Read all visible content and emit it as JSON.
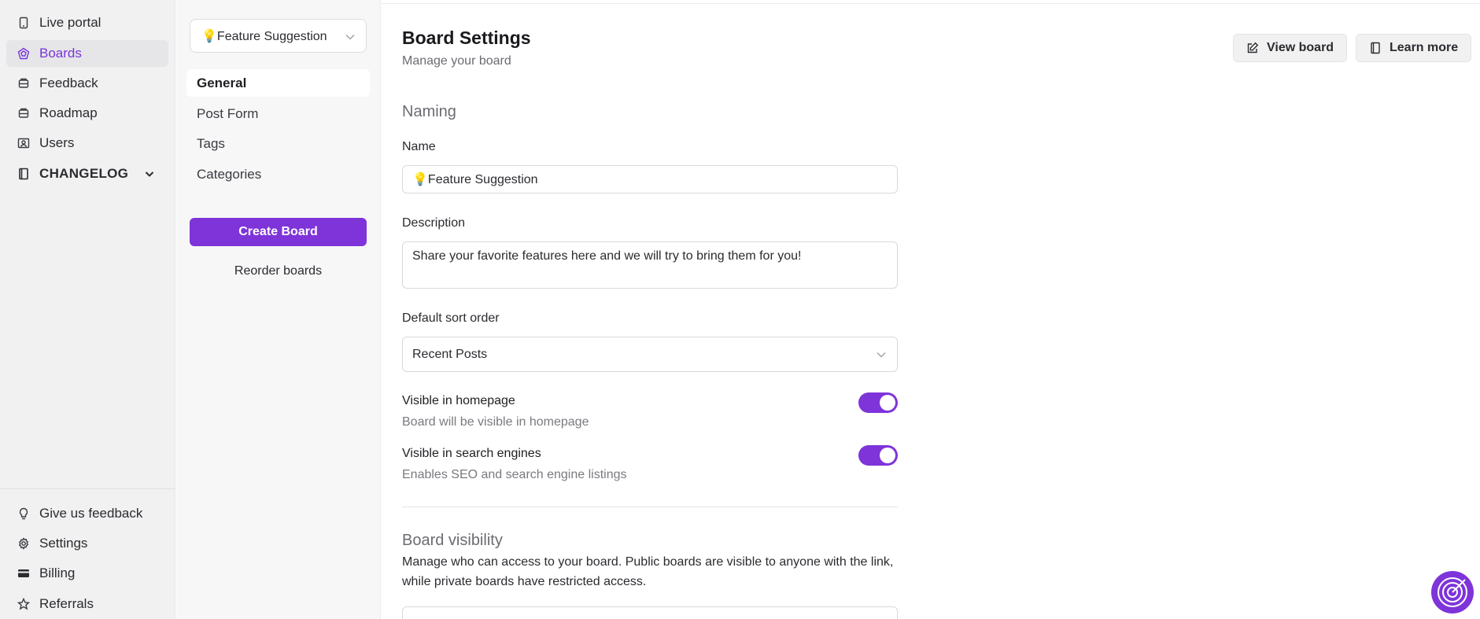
{
  "sidebar": {
    "items": [
      {
        "label": "Live portal",
        "icon": "tablet-icon"
      },
      {
        "label": "Boards",
        "icon": "boards-icon",
        "active": true
      },
      {
        "label": "Feedback",
        "icon": "inbox-icon"
      },
      {
        "label": "Roadmap",
        "icon": "inbox-icon"
      },
      {
        "label": "Users",
        "icon": "users-icon"
      },
      {
        "label": "CHANGELOG",
        "icon": "book-icon"
      }
    ],
    "bottom_items": [
      {
        "label": "Give us feedback",
        "icon": "lightbulb-icon"
      },
      {
        "label": "Settings",
        "icon": "gear-icon"
      },
      {
        "label": "Billing",
        "icon": "credit-card-icon"
      },
      {
        "label": "Referrals",
        "icon": "star-icon"
      }
    ]
  },
  "board_panel": {
    "selected_board": "💡Feature Suggestion",
    "tabs": [
      "General",
      "Post Form",
      "Tags",
      "Categories"
    ],
    "create_label": "Create Board",
    "reorder_label": "Reorder boards"
  },
  "header": {
    "title": "Board Settings",
    "subtitle": "Manage your board",
    "view_board_label": "View board",
    "learn_more_label": "Learn more"
  },
  "form": {
    "naming_title": "Naming",
    "name_label": "Name",
    "name_value": "💡Feature Suggestion",
    "description_label": "Description",
    "description_value": "Share your favorite features here and we will try to bring them for you!",
    "sort_label": "Default sort order",
    "sort_value": "Recent Posts",
    "toggles": [
      {
        "label": "Visible in homepage",
        "description": "Board will be visible in homepage",
        "on": true
      },
      {
        "label": "Visible in search engines",
        "description": "Enables SEO and search engine listings",
        "on": true
      }
    ],
    "visibility_title": "Board visibility",
    "visibility_description": "Manage who can access to your board. Public boards are visible to anyone with the link, while private boards have restricted access."
  },
  "colors": {
    "accent": "#7e34d9",
    "sidebar_bg": "#f1f1f2",
    "panel_bg": "#f7f7f8"
  }
}
